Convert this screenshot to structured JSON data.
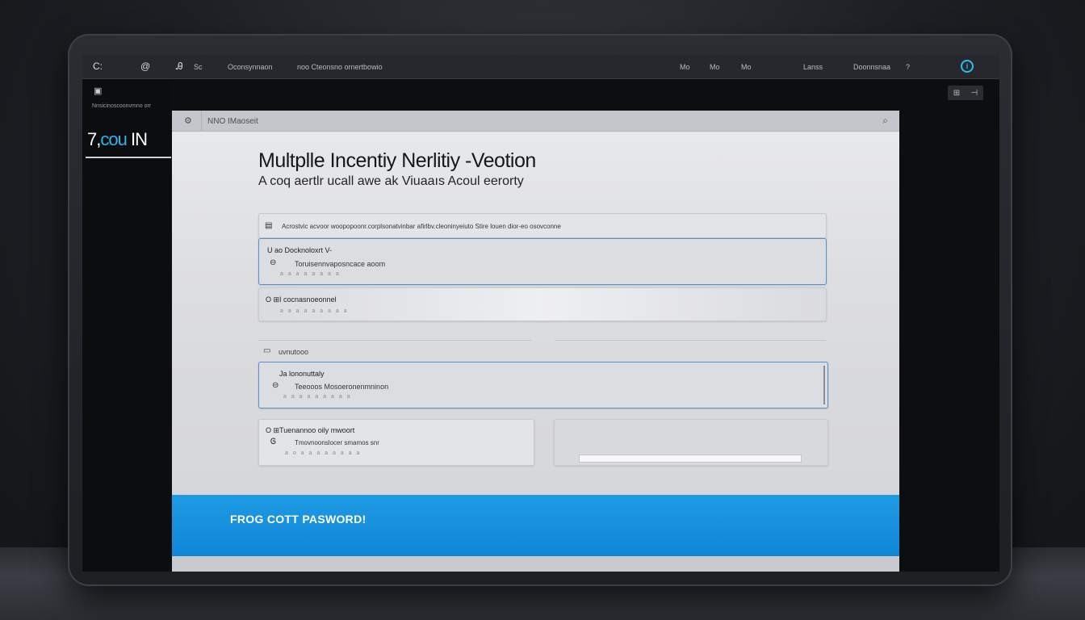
{
  "menubar": {
    "items": [
      "C:",
      "@",
      "Ꭿ",
      "Sc",
      "Oconsynnaon",
      "noo Cteonsno ornertbowio"
    ],
    "right_items": [
      "Mo",
      "Mo",
      "Mo",
      "Lanss",
      "Doonnsnaa",
      "?"
    ],
    "account_icon": "info-icon"
  },
  "sidebar": {
    "text": "Nnsicinoscoonvmno orr",
    "logo_part1": "7,",
    "logo_part2": "cou",
    "logo_part3": " IN"
  },
  "window": {
    "title": "NNO IMaoseit"
  },
  "main": {
    "heading": "Multplle Incentiy Nerlitiy -Veotion",
    "subheading": "A coq aertlr ucall awe ak Viuaaıs Acoul eerorty",
    "notice": "Acrostvic acvoor woopopoonr.corplsonatvinbar afirlbv.cleoninyeiuto Stire louen dior-eo osovconne",
    "option1": {
      "title": "U ao Docknoloxrt V-",
      "line1": "Toruisennvaposncace aoom",
      "dots": "a a a a a a a a"
    },
    "option2": {
      "title": "O ⊞I cocnasnoeonnel",
      "line1": "a a a a a a a a a"
    },
    "section_label": "uvnutooo",
    "option3": {
      "title": "Ja lononuttaly",
      "line1": "Teeooos Mosoeronenmninon",
      "dots": "a a a a a a a a a"
    },
    "option4": {
      "title": "O ⊞Tuenannoo oily mwoort",
      "line1": "Tmovnoonslocer smamos snr",
      "dots": "a o a a a a a a a a"
    },
    "cta_label": "FROG COTT PASWORD!"
  },
  "tools": [
    "⊞",
    "⊣"
  ]
}
